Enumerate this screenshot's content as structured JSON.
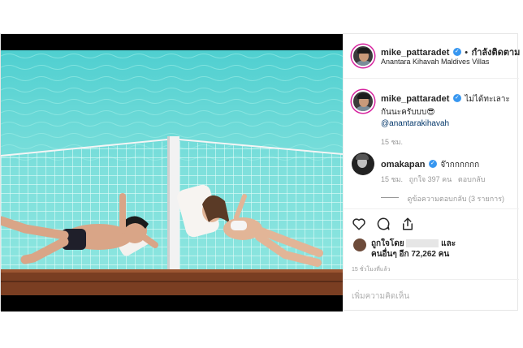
{
  "post_header": {
    "username": "mike_pattaradet",
    "follow_status": "กำลังติดตาม",
    "location": "Anantara Kihavah Maldives Villas"
  },
  "caption": {
    "username": "mike_pattaradet",
    "text": "ไม่ได้ทะเลาะกันนะครับบบ😎",
    "mention": "@anantarakihavah",
    "time": "15 ชม."
  },
  "comment": {
    "username": "omakapan",
    "text": "จ๊ากกกกกก",
    "time": "15 ชม.",
    "likes": "ถูกใจ 397 คน",
    "reply": "ตอบกลับ",
    "view_replies": "ดูข้อความตอบกลับ (3 รายการ)"
  },
  "likes_summary": {
    "line1": "ถูกใจโดย",
    "line1_end": "และ",
    "line2": "คนอื่นๆ อีก 72,262 คน"
  },
  "post_time": "15 ชั่วโมงที่แล้ว",
  "add_comment_placeholder": "เพิ่มความคิดเห็น",
  "icons": {
    "like": "heart-icon",
    "comment": "comment-icon",
    "share": "share-icon"
  },
  "colors": {
    "verified": "#3897f0",
    "water": "#5fd6d2",
    "link": "#003569"
  }
}
